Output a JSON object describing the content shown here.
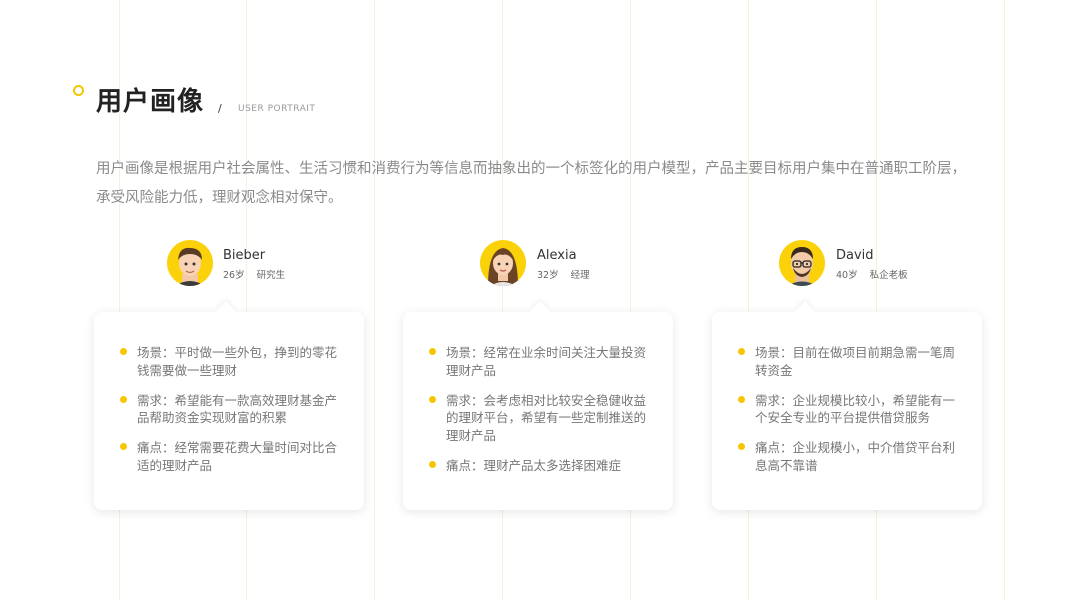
{
  "header": {
    "title": "用户画像",
    "separator": "/",
    "subtitle": "USER PORTRAIT"
  },
  "intro": "用户画像是根据用户社会属性、生活习惯和消费行为等信息而抽象出的一个标签化的用户模型，产品主要目标用户集中在普通职工阶层，承受风险能力低，理财观念相对保守。",
  "colors": {
    "accent": "#f7c600",
    "avatar_bg": "#fbd20a"
  },
  "personas": [
    {
      "name": "Bieber",
      "age": "26岁",
      "job": "研究生",
      "items": [
        "场景：平时做一些外包，挣到的零花钱需要做一些理财",
        "需求：希望能有一款高效理财基金产品帮助资金实现财富的积累",
        "痛点：经常需要花费大量时间对比合适的理财产品"
      ]
    },
    {
      "name": "Alexia",
      "age": "32岁",
      "job": "经理",
      "items": [
        "场景：经常在业余时间关注大量投资理财产品",
        "需求：会考虑相对比较安全稳健收益的理财平台，希望有一些定制推送的理财产品",
        "痛点：理财产品太多选择困难症"
      ]
    },
    {
      "name": "David",
      "age": "40岁",
      "job": "私企老板",
      "items": [
        "场景：目前在做项目前期急需一笔周转资金",
        "需求：企业规模比较小，希望能有一个安全专业的平台提供借贷服务",
        "痛点：企业规模小，中介借贷平台利息高不靠谱"
      ]
    }
  ]
}
